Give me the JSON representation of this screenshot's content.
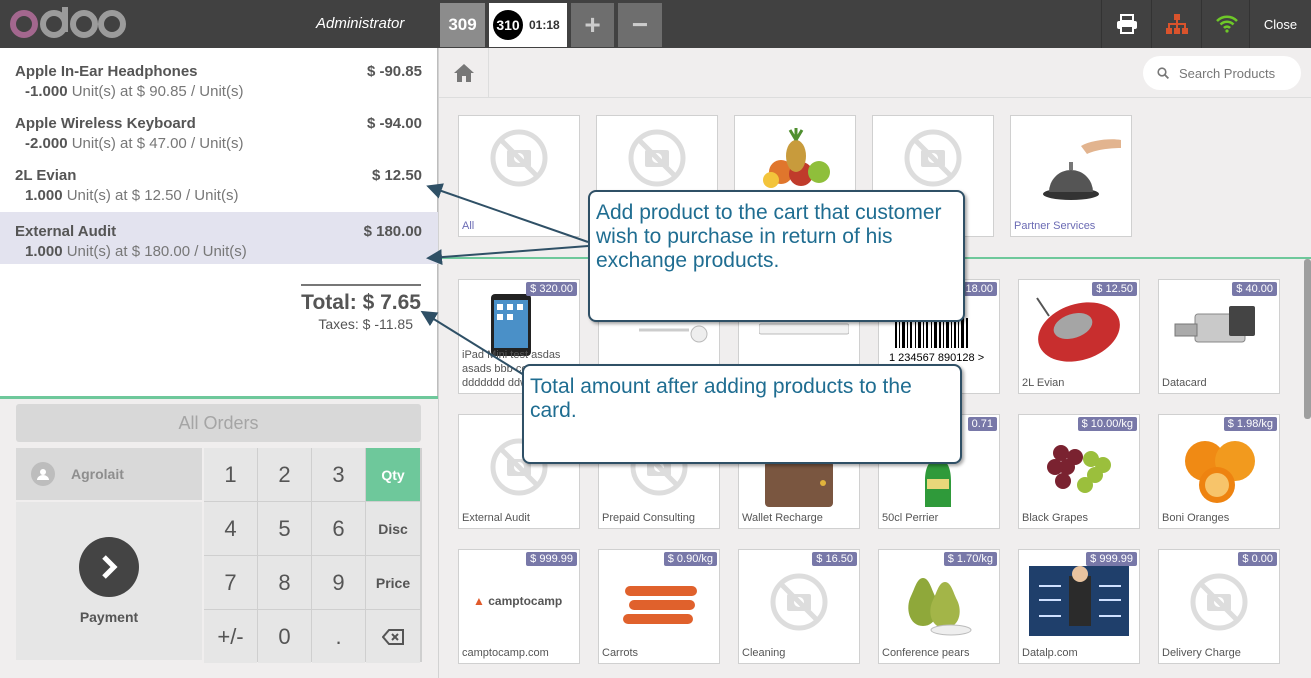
{
  "topbar": {
    "user": "Administrator",
    "order_tabs": [
      {
        "number": "309"
      },
      {
        "number": "310",
        "time": "01:18"
      }
    ],
    "add_order": "+",
    "remove_order": "−",
    "close_label": "Close"
  },
  "orderlines": [
    {
      "name": "Apple In-Ear Headphones",
      "price": "$ -90.85",
      "qty": "-1.000",
      "detail": "Unit(s) at $ 90.85 / Unit(s)"
    },
    {
      "name": "Apple Wireless Keyboard",
      "price": "$ -94.00",
      "qty": "-2.000",
      "detail": "Unit(s) at $ 47.00 / Unit(s)"
    },
    {
      "name": "2L Evian",
      "price": "$ 12.50",
      "qty": "1.000",
      "detail": "Unit(s) at $ 12.50 / Unit(s)"
    },
    {
      "name": "External Audit",
      "price": "$ 180.00",
      "qty": "1.000",
      "detail": "Unit(s) at $ 180.00 / Unit(s)"
    }
  ],
  "summary": {
    "total": "Total: $ 7.65",
    "taxes": "Taxes: $ -11.85"
  },
  "controls": {
    "all_orders": "All Orders",
    "customer": "Agrolait",
    "payment": "Payment",
    "keys": [
      "1",
      "2",
      "3",
      "Qty",
      "4",
      "5",
      "6",
      "Disc",
      "7",
      "8",
      "9",
      "Price",
      "+/-",
      "0",
      "."
    ]
  },
  "search": {
    "placeholder": "Search Products"
  },
  "categories": [
    {
      "label": "All"
    },
    {
      "label": ""
    },
    {
      "label": ""
    },
    {
      "label": ""
    },
    {
      "label": "Partner Services"
    }
  ],
  "products": [
    {
      "name": "iPad Mini test asdas asads bbb ccc ddddddd ddw",
      "price": "$ 320.00"
    },
    {
      "name": "",
      "price": ""
    },
    {
      "name": "",
      "price": ""
    },
    {
      "name": "",
      "price": "18.00"
    },
    {
      "name": "2L Evian",
      "price": "$ 12.50"
    },
    {
      "name": "Datacard",
      "price": "$ 40.00"
    },
    {
      "name": "External Audit",
      "price": ""
    },
    {
      "name": "Prepaid Consulting",
      "price": ""
    },
    {
      "name": "Wallet Recharge",
      "price": ""
    },
    {
      "name": "50cl Perrier",
      "price": "0.71"
    },
    {
      "name": "Black Grapes",
      "price": "$ 10.00/kg"
    },
    {
      "name": "Boni Oranges",
      "price": "$ 1.98/kg"
    },
    {
      "name": "camptocamp.com",
      "price": "$ 999.99"
    },
    {
      "name": "Carrots",
      "price": "$ 0.90/kg"
    },
    {
      "name": "Cleaning",
      "price": "$ 16.50"
    },
    {
      "name": "Conference pears",
      "price": "$ 1.70/kg"
    },
    {
      "name": "Datalp.com",
      "price": "$ 999.99"
    },
    {
      "name": "Delivery Charge",
      "price": "$ 0.00"
    }
  ],
  "barcode_text": "1 234567 890128 >",
  "camptocamp_logo": "camptocamp",
  "callouts": {
    "add_product": "Add product to the cart that customer wish to purchase in return of his exchange products.",
    "total_amount": "Total amount after adding products to the card."
  },
  "colors": {
    "accent_green": "#6ec89b",
    "topbar": "#414141",
    "price_tag": "#7878a8",
    "callout_text": "#1f6d91"
  }
}
